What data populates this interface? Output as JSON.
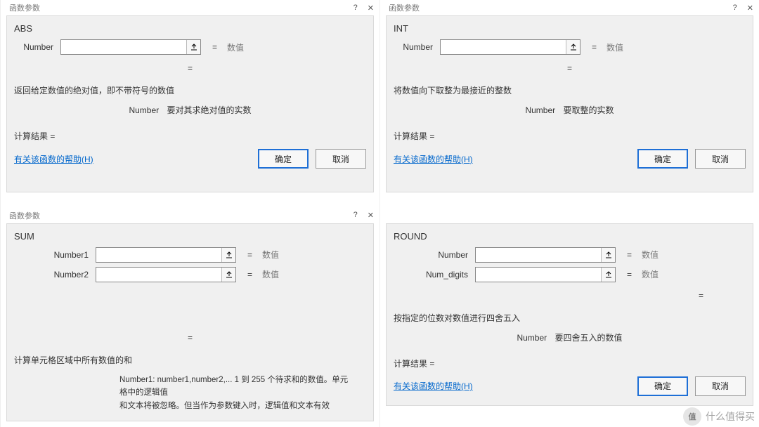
{
  "common": {
    "dialog_title": "函数参数",
    "eq": "=",
    "val_hint": "数值",
    "help_link": "有关该函数的帮助(H)",
    "ok": "确定",
    "cancel": "取消",
    "result_label": "计算结果 ="
  },
  "abs": {
    "fn": "ABS",
    "arg_label": "Number",
    "desc": "返回给定数值的绝对值，即不带符号的数值",
    "param_name": "Number",
    "param_desc": "要对其求绝对值的实数"
  },
  "int": {
    "fn": "INT",
    "arg_label": "Number",
    "desc": "将数值向下取整为最接近的整数",
    "param_name": "Number",
    "param_desc": "要取整的实数"
  },
  "sum": {
    "fn": "SUM",
    "arg1_label": "Number1",
    "arg2_label": "Number2",
    "desc": "计算单元格区域中所有数值的和",
    "long1": "Number1:  number1,number2,...  1 到 255 个待求和的数值。单元格中的逻辑值",
    "long2": "和文本将被忽略。但当作为参数键入时，逻辑值和文本有效"
  },
  "round": {
    "fn": "ROUND",
    "arg1_label": "Number",
    "arg2_label": "Num_digits",
    "desc": "按指定的位数对数值进行四舍五入",
    "param_name": "Number",
    "param_desc": "要四舍五入的数值"
  },
  "watermark": {
    "badge": "值",
    "text": "什么值得买"
  }
}
